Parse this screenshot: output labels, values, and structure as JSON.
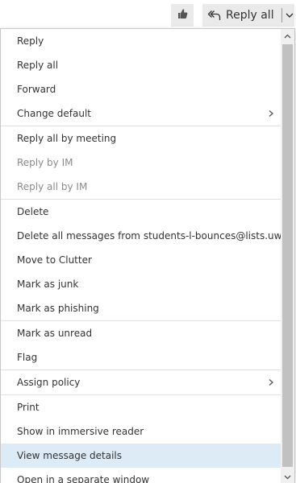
{
  "toolbar": {
    "like_icon": "thumbs-up-icon",
    "reply_all_icon": "reply-all-icon",
    "reply_all_label": "Reply all",
    "dropdown_icon": "chevron-down-icon"
  },
  "menu": {
    "items": [
      {
        "label": "Reply"
      },
      {
        "label": "Reply all"
      },
      {
        "label": "Forward"
      },
      {
        "label": "Change default",
        "submenu": true
      },
      {
        "label": "Reply all by meeting"
      },
      {
        "label": "Reply by IM",
        "disabled": true
      },
      {
        "label": "Reply all by IM",
        "disabled": true
      },
      {
        "label": "Delete"
      },
      {
        "label": "Delete all messages from students-l-bounces@lists.uwplatt.edu"
      },
      {
        "label": "Move to Clutter"
      },
      {
        "label": "Mark as junk"
      },
      {
        "label": "Mark as phishing"
      },
      {
        "label": "Mark as unread"
      },
      {
        "label": "Flag"
      },
      {
        "label": "Assign policy",
        "submenu": true
      },
      {
        "label": "Print"
      },
      {
        "label": "Show in immersive reader"
      },
      {
        "label": "View message details",
        "highlighted": true
      },
      {
        "label": "Open in a separate window"
      }
    ]
  },
  "colors": {
    "highlight": "#ddebf7",
    "disabled_text": "#8a8a8a",
    "text": "#333333"
  }
}
